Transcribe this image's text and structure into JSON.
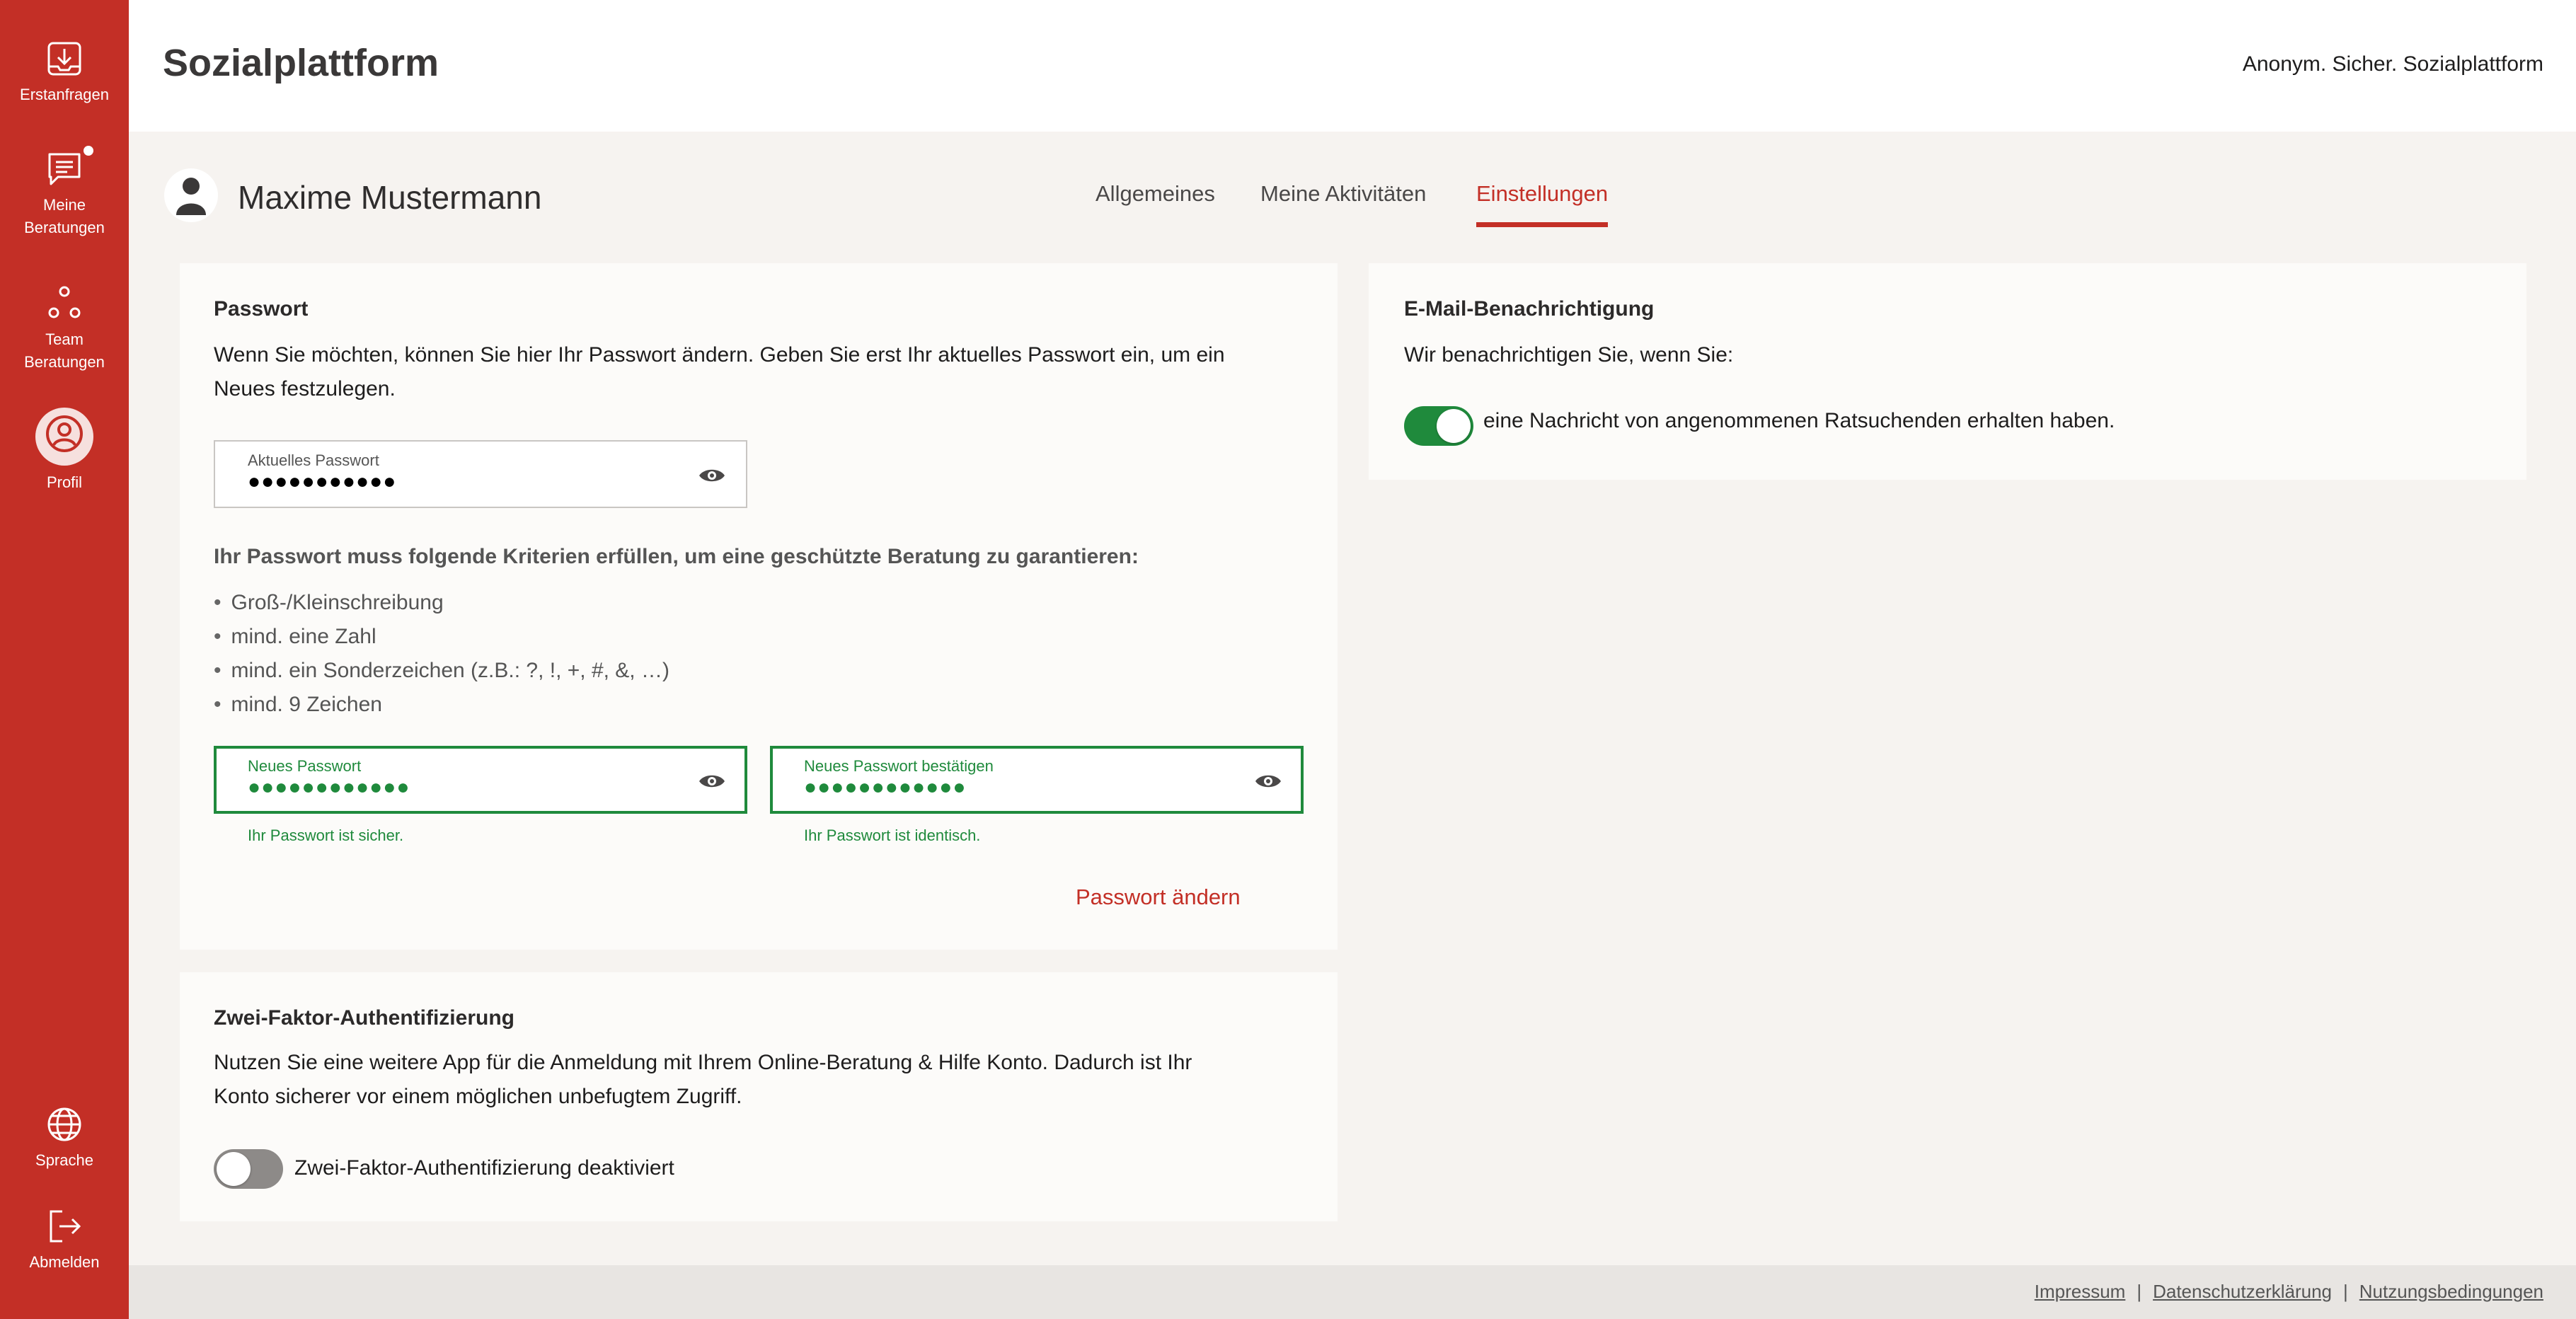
{
  "sidebar": {
    "items": [
      {
        "label": "Erstanfragen",
        "icon": "inbox-download-icon"
      },
      {
        "label_line1": "Meine",
        "label_line2": "Beratungen",
        "icon": "chat-icon"
      },
      {
        "label_line1": "Team",
        "label_line2": "Beratungen",
        "icon": "team-icon"
      },
      {
        "label": "Profil",
        "icon": "user-circle-icon"
      }
    ],
    "bottom_items": [
      {
        "label": "Sprache",
        "icon": "globe-icon"
      },
      {
        "label": "Abmelden",
        "icon": "logout-icon"
      }
    ],
    "accent_color": "#c32f26"
  },
  "header": {
    "title": "Sozialplattform",
    "tagline": "Anonym. Sicher. Sozialplattform"
  },
  "profile": {
    "name": "Maxime Mustermann",
    "tabs": [
      {
        "label": "Allgemeines",
        "active": false
      },
      {
        "label": "Meine Aktivitäten",
        "active": false
      },
      {
        "label": "Einstellungen",
        "active": true
      }
    ]
  },
  "password_card": {
    "title": "Passwort",
    "description_line1": "Wenn Sie möchten, können Sie hier Ihr Passwort ändern. Geben Sie erst Ihr aktuelles Passwort ein, um ein",
    "description_line2": "Neues festzulegen.",
    "current_field": {
      "label": "Aktuelles Passwort",
      "value": "●●●●●●●●●●●"
    },
    "criteria_title": "Ihr Passwort muss folgende Kriterien erfüllen, um eine geschützte Beratung zu garantieren:",
    "criteria": [
      "Groß-/Kleinschreibung",
      "mind. eine Zahl",
      "mind. ein Sonderzeichen (z.B.: ?, !, +, #, &, …)",
      "mind. 9 Zeichen"
    ],
    "new_field": {
      "label": "Neues Passwort",
      "value": "●●●●●●●●●●●●",
      "hint": "Ihr Passwort ist sicher."
    },
    "confirm_field": {
      "label": "Neues Passwort bestätigen",
      "value": "●●●●●●●●●●●●",
      "hint": "Ihr Passwort ist identisch."
    },
    "submit_label": "Passwort ändern"
  },
  "twofa_card": {
    "title": "Zwei-Faktor-Authentifizierung",
    "description_line1": "Nutzen Sie eine weitere App für die Anmeldung mit Ihrem Online-Beratung & Hilfe Konto. Dadurch ist Ihr",
    "description_line2": "Konto sicherer vor einem möglichen unbefugtem Zugriff.",
    "toggle_label": "Zwei-Faktor-Authentifizierung deaktiviert",
    "enabled": false
  },
  "email_card": {
    "title": "E-Mail-Benachrichtigung",
    "description": "Wir benachrichtigen Sie, wenn Sie:",
    "toggle_label": "eine Nachricht von angenommenen Ratsuchenden erhalten haben.",
    "enabled": true
  },
  "footer": {
    "links": [
      "Impressum",
      "Datenschutzerklärung",
      "Nutzungsbedingungen"
    ],
    "separator": "|"
  }
}
